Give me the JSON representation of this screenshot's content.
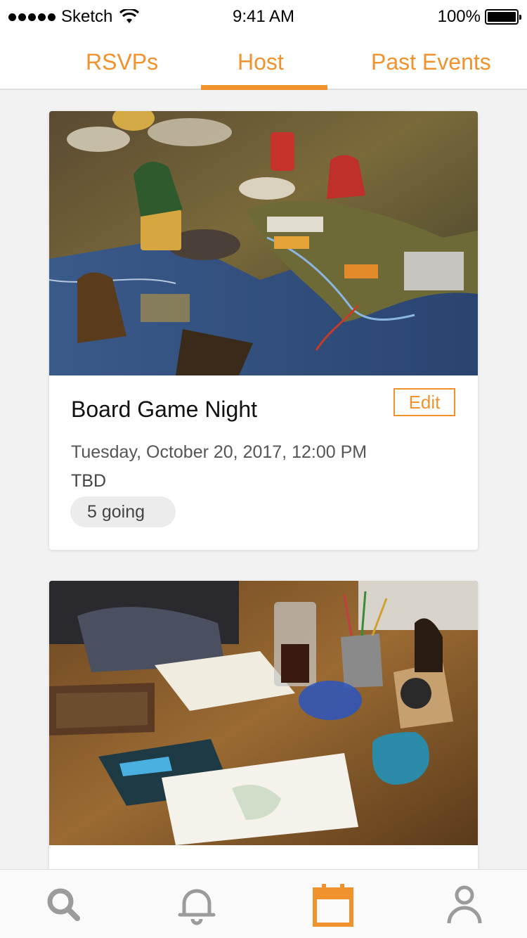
{
  "status_bar": {
    "carrier": "Sketch",
    "time": "9:41 AM",
    "battery": "100%"
  },
  "tabs": [
    {
      "label": "RSVPs",
      "active": false
    },
    {
      "label": "Host",
      "active": true
    },
    {
      "label": "Past Events",
      "active": false
    }
  ],
  "events": [
    {
      "title": "Board Game Night",
      "edit_label": "Edit",
      "datetime": "Tuesday, October 20, 2017, 12:00 PM",
      "location": "TBD",
      "going": "5 going",
      "image": "board-game-photo"
    },
    {
      "image": "sketching-coffee-table-photo"
    }
  ],
  "bottom_nav": [
    {
      "icon": "search-icon",
      "active": false
    },
    {
      "icon": "bell-icon",
      "active": false
    },
    {
      "icon": "calendar-icon",
      "active": true
    },
    {
      "icon": "profile-icon",
      "active": false
    }
  ],
  "colors": {
    "accent": "#f0922e",
    "inactive_icon": "#9b9b9b",
    "background": "#f2f2f2"
  }
}
